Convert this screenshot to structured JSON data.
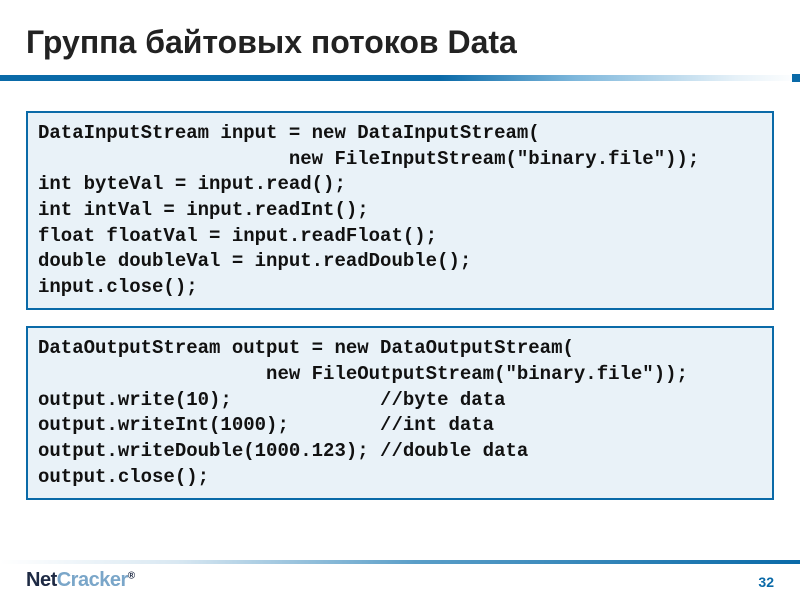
{
  "title": "Группа байтовых потоков Data",
  "code_block_1": "DataInputStream input = new DataInputStream(\n                      new FileInputStream(\"binary.file\"));\nint byteVal = input.read();\nint intVal = input.readInt();\nfloat floatVal = input.readFloat();\ndouble doubleVal = input.readDouble();\ninput.close();",
  "code_block_2": "DataOutputStream output = new DataOutputStream(\n                    new FileOutputStream(\"binary.file\"));\noutput.write(10);             //byte data\noutput.writeInt(1000);        //int data\noutput.writeDouble(1000.123); //double data\noutput.close();",
  "logo": {
    "part1": "Net",
    "part2": "Cracker",
    "mark": "®"
  },
  "page_number": "32"
}
